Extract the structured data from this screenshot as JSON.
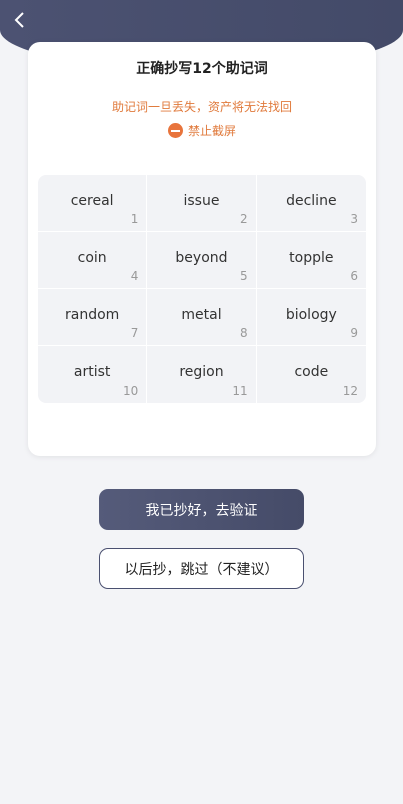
{
  "header": {
    "back_icon": "chevron-left-icon"
  },
  "card": {
    "title": "正确抄写12个助记词",
    "warning": "助记词一旦丢失，资产将无法找回",
    "no_screenshot": "禁止截屏",
    "no_screenshot_icon": "minus-circle-icon",
    "accent_color": "#e07a3c"
  },
  "mnemonic": [
    {
      "word": "cereal",
      "index": "1"
    },
    {
      "word": "issue",
      "index": "2"
    },
    {
      "word": "decline",
      "index": "3"
    },
    {
      "word": "coin",
      "index": "4"
    },
    {
      "word": "beyond",
      "index": "5"
    },
    {
      "word": "topple",
      "index": "6"
    },
    {
      "word": "random",
      "index": "7"
    },
    {
      "word": "metal",
      "index": "8"
    },
    {
      "word": "biology",
      "index": "9"
    },
    {
      "word": "artist",
      "index": "10"
    },
    {
      "word": "region",
      "index": "11"
    },
    {
      "word": "code",
      "index": "12"
    }
  ],
  "buttons": {
    "verify": "我已抄好，去验证",
    "skip": "以后抄，跳过（不建议）"
  }
}
